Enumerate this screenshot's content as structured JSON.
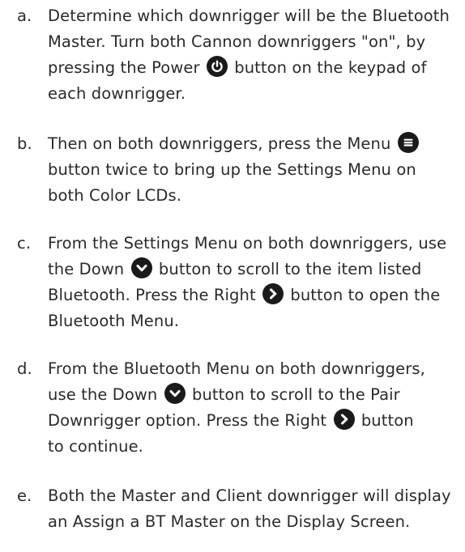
{
  "steps": [
    {
      "marker": "a.",
      "lines": [
        [
          "Determine which downrigger will be the Bluetooth"
        ],
        [
          "Master. Turn both Cannon downriggers \"on\", by"
        ],
        [
          "pressing the Power",
          "button on the keypad of"
        ],
        [
          "each downrigger."
        ]
      ]
    },
    {
      "marker": "b.",
      "lines": [
        [
          "Then on both downriggers, press the Menu",
          ""
        ],
        [
          "button twice to bring up the Settings Menu on"
        ],
        [
          "both Color LCDs."
        ]
      ]
    },
    {
      "marker": "c.",
      "lines": [
        [
          "From the Settings Menu on both downriggers, use"
        ],
        [
          "the Down",
          "button to scroll to the item listed"
        ],
        [
          "Bluetooth. Press the Right",
          "button to open the"
        ],
        [
          "Bluetooth Menu."
        ]
      ]
    },
    {
      "marker": "d.",
      "lines": [
        [
          "From the Bluetooth Menu on both downriggers,"
        ],
        [
          "use the Down",
          "button to scroll to the Pair"
        ],
        [
          "Downrigger option. Press the Right",
          "button"
        ],
        [
          "to continue."
        ]
      ]
    },
    {
      "marker": "e.",
      "lines": [
        [
          "Both the Master and Client downrigger will display"
        ],
        [
          "an Assign a BT Master on the Display Screen."
        ]
      ]
    }
  ],
  "icons": {
    "power": "power-icon",
    "menu": "menu-icon",
    "down": "chevron-down-icon",
    "right": "chevron-right-icon",
    "fill_color": "#1a1a1a",
    "glyph_color": "#ffffff"
  }
}
